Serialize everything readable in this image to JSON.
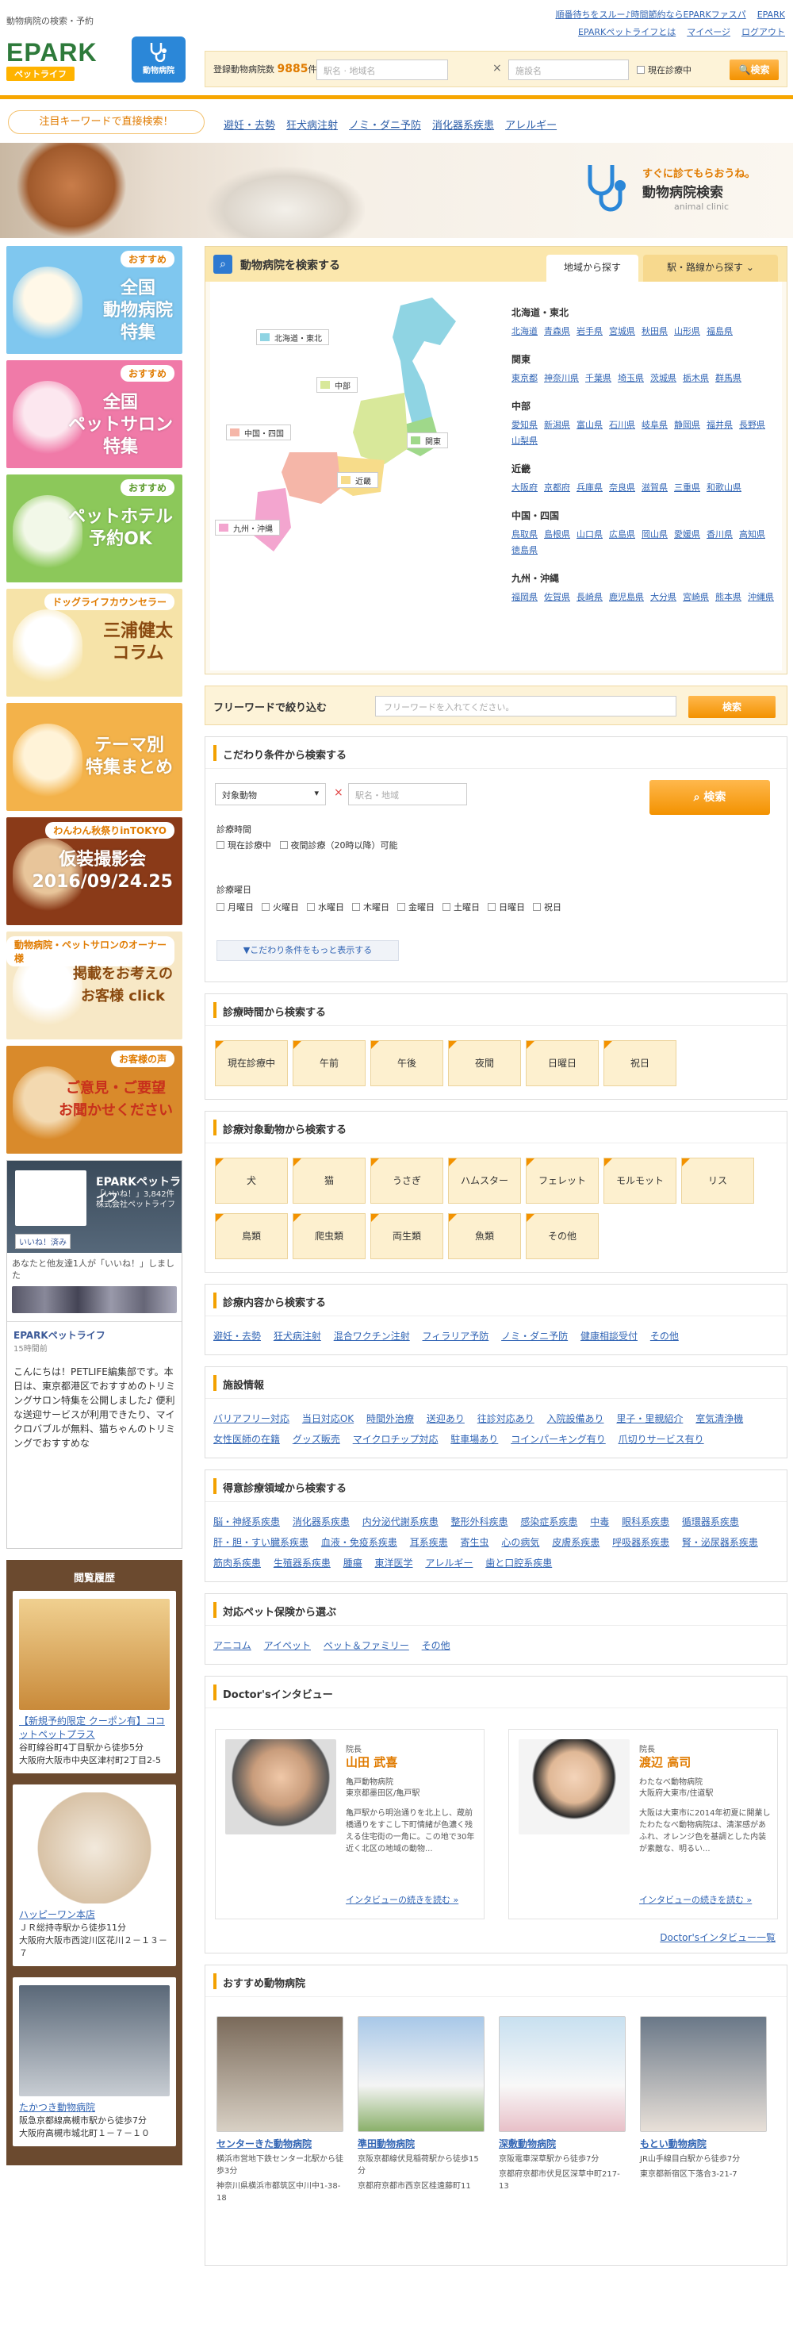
{
  "header": {
    "tagline": "動物病院の検索・予約",
    "logo_text": "EPARK",
    "logo_sub": "ペットライフ",
    "badge_label": "動物病院",
    "top_links": [
      "順番待ちをスルー♪時間節約ならEPARKファスパ",
      "EPARK"
    ],
    "nav_links": [
      "EPARKペットライフとは",
      "マイページ",
      "ログアウト"
    ],
    "registered_label": "登録動物病院数",
    "registered_count": "9885",
    "registered_unit": "件",
    "station_placeholder": "駅名 · 地域名",
    "clinic_placeholder": "施設名",
    "open_now_label": "現在診療中",
    "search_button": "検索"
  },
  "keywords": {
    "label": "注目キーワードで直接検索！",
    "items": [
      "避妊・去勢",
      "狂犬病注射",
      "ノミ・ダニ予防",
      "消化器系疾患",
      "アレルギー"
    ]
  },
  "hero": {
    "line1": "すぐに診てもらおうね。",
    "line2": "動物病院検索",
    "line3": "animal clinic"
  },
  "left_banners": [
    {
      "pill": "おすすめ",
      "title": "全国\n動物病院\n特集",
      "bg": "#7fc7ef"
    },
    {
      "pill": "おすすめ",
      "title": "全国\nペットサロン\n特集",
      "bg": "#f07aa8"
    },
    {
      "pill": "おすすめ",
      "title": "ペットホテル\n予約OK",
      "bg": "#8cc85a"
    },
    {
      "pill": "ドッグライフカウンセラー",
      "title": "三浦健太\nコラム",
      "bg": "#f6e3a8"
    },
    {
      "pill": "",
      "title": "テーマ別\n特集まとめ",
      "bg": "#f3b24a"
    },
    {
      "pill": "わんわん秋祭りinTOKYO",
      "title": "仮装撮影会\n2016/09/24.25",
      "bg": "#8a3a18"
    },
    {
      "pill": "動物病院・ペットサロンのオーナー様",
      "title": "掲載をお考えの\nお客様 click",
      "bg": "#f7e8c6"
    },
    {
      "pill": "お客様の声",
      "title": "ご意見・ご要望\nお聞かせください",
      "bg": "#d98a2b"
    }
  ],
  "facebook": {
    "page_name": "EPARKペットライフ",
    "likes": "「いいね！」3,842件",
    "company": "株式会社ペットライフ",
    "like_button": "いいね！済み",
    "friends_text": "あなたと他友達1人が「いいね！」しました",
    "post_name": "EPARKペットライフ",
    "post_time": "15時間前",
    "post_body": "こんにちは！PETLIFE編集部です。本日は、東京都港区でおすすめのトリミングサロン特集を公開しました♪ 便利な送迎サービスが利用できたり、マイクロバブルが無料、猫ちゃんのトリミングでおすすめな"
  },
  "history": {
    "title": "閲覧履歴",
    "items": [
      {
        "name": "【新規予約限定 クーポン有】ココットペットプラス",
        "access": "谷町線谷町4丁目駅から徒歩5分",
        "address": "大阪府大阪市中央区津村町2丁目2-5"
      },
      {
        "name": "ハッピーワン本店",
        "access": "ＪＲ総持寺駅から徒歩11分",
        "address": "大阪府大阪市西淀川区花川２－１３－７"
      },
      {
        "name": "たかつき動物病院",
        "access": "阪急京都線高槻市駅から徒歩7分",
        "address": "大阪府高槻市城北町１－７－１０"
      }
    ]
  },
  "map_search": {
    "title": "動物病院を検索する",
    "tab_area": "地域から探す",
    "tab_station": "駅・路線から探す",
    "map_tags": [
      "北海道・東北",
      "中部",
      "関東",
      "中国・四国",
      "近畿",
      "九州・沖縄"
    ],
    "regions": [
      {
        "name": "北海道・東北",
        "prefs": [
          "北海道",
          "青森県",
          "岩手県",
          "宮城県",
          "秋田県",
          "山形県",
          "福島県"
        ]
      },
      {
        "name": "関東",
        "prefs": [
          "東京都",
          "神奈川県",
          "千葉県",
          "埼玉県",
          "茨城県",
          "栃木県",
          "群馬県"
        ]
      },
      {
        "name": "中部",
        "prefs": [
          "愛知県",
          "新潟県",
          "富山県",
          "石川県",
          "岐阜県",
          "静岡県",
          "福井県",
          "長野県",
          "山梨県"
        ]
      },
      {
        "name": "近畿",
        "prefs": [
          "大阪府",
          "京都府",
          "兵庫県",
          "奈良県",
          "滋賀県",
          "三重県",
          "和歌山県"
        ]
      },
      {
        "name": "中国・四国",
        "prefs": [
          "鳥取県",
          "島根県",
          "山口県",
          "広島県",
          "岡山県",
          "愛媛県",
          "香川県",
          "高知県",
          "徳島県"
        ]
      },
      {
        "name": "九州・沖縄",
        "prefs": [
          "福岡県",
          "佐賀県",
          "長崎県",
          "鹿児島県",
          "大分県",
          "宮崎県",
          "熊本県",
          "沖縄県"
        ]
      }
    ]
  },
  "free_word": {
    "label": "フリーワードで絞り込む",
    "placeholder": "フリーワードを入れてください。",
    "button": "検索"
  },
  "conditions": {
    "title": "こだわり条件から検索する",
    "select_value": "対象動物",
    "area_placeholder": "駅名・地域",
    "search_button": "検索",
    "time_label": "診療時間",
    "time_opts": [
      "現在診療中",
      "夜間診療（20時以降）可能"
    ],
    "day_label": "診療曜日",
    "days": [
      "月曜日",
      "火曜日",
      "水曜日",
      "木曜日",
      "金曜日",
      "土曜日",
      "日曜日",
      "祝日"
    ],
    "more": "▼こだわり条件をもっと表示する"
  },
  "time_search": {
    "title": "診療時間から検索する",
    "items": [
      "現在診療中",
      "午前",
      "午後",
      "夜間",
      "日曜日",
      "祝日"
    ]
  },
  "animal_search": {
    "title": "診療対象動物から検索する",
    "items": [
      "犬",
      "猫",
      "うさぎ",
      "ハムスター",
      "フェレット",
      "モルモット",
      "リス",
      "鳥類",
      "爬虫類",
      "両生類",
      "魚類",
      "その他"
    ]
  },
  "content_search": {
    "title": "診療内容から検索する",
    "items": [
      "避妊・去勢",
      "狂犬病注射",
      "混合ワクチン注射",
      "フィラリア予防",
      "ノミ・ダニ予防",
      "健康相談受付",
      "その他"
    ]
  },
  "facility": {
    "title": "施設情報",
    "items": [
      "バリアフリー対応",
      "当日対応OK",
      "時間外治療",
      "送迎あり",
      "往診対応あり",
      "入院設備あり",
      "里子・里親紹介",
      "室気清浄機",
      "女性医師の在籍",
      "グッズ販売",
      "マイクロチップ対応",
      "駐車場あり",
      "コインパーキング有り",
      "爪切りサービス有り"
    ]
  },
  "specialty": {
    "title": "得意診療領域から検索する",
    "items": [
      "脳・神経系疾患",
      "消化器系疾患",
      "内分泌代謝系疾患",
      "整形外科疾患",
      "感染症系疾患",
      "中毒",
      "眼科系疾患",
      "循環器系疾患",
      "肝・胆・すい臓系疾患",
      "血液・免疫系疾患",
      "耳系疾患",
      "寄生虫",
      "心の病気",
      "皮膚系疾患",
      "呼吸器系疾患",
      "腎・泌尿器系疾患",
      "筋肉系疾患",
      "生殖器系疾患",
      "腫瘍",
      "東洋医学",
      "アレルギー",
      "歯と口腔系疾患"
    ]
  },
  "insurance": {
    "title": "対応ペット保険から選ぶ",
    "items": [
      "アニコム",
      "アイペット",
      "ペット＆ファミリー",
      "その他"
    ]
  },
  "doctors": {
    "title": "Doctor'sインタビュー",
    "more": "Doctor'sインタビュー一覧",
    "items": [
      {
        "role": "院長",
        "name": "山田 武喜",
        "clinic": "亀戸動物病院",
        "area": "東京都墨田区/亀戸駅",
        "body": "亀戸駅から明治通りを北上し、蔵前橋通りをすこし下町情緒が色濃く残える住宅街の一角に。この地で30年近く北区の地域の動物...",
        "link": "インタビューの続きを読む »"
      },
      {
        "role": "院長",
        "name": "渡辺 高司",
        "clinic": "わたなべ動物病院",
        "area": "大阪府大東市/住道駅",
        "body": "大阪は大東市に2014年初夏に開業したわたなべ動物病院は、清潔感があふれ、オレンジ色を基調とした内装が素敵な、明るい...",
        "link": "インタビューの続きを読む »"
      }
    ]
  },
  "recommend": {
    "title": "おすすめ動物病院",
    "items": [
      {
        "name": "センターきた動物病院",
        "access": "横浜市営地下鉄センター北駅から徒歩3分",
        "address": "神奈川県横浜市都筑区中川中1-38-18"
      },
      {
        "name": "準田動物病院",
        "access": "京阪京都線伏見稲荷駅から徒歩15分",
        "address": "京都府京都市西京区桂遠藤町11"
      },
      {
        "name": "深敷動物病院",
        "access": "京阪電車深草駅から徒歩7分",
        "address": "京都府京都市伏見区深草中町217-13"
      },
      {
        "name": "もとい動物病院",
        "access": "JR山手線目白駅から徒歩7分",
        "address": "東京都新宿区下落合3-21-7"
      }
    ]
  }
}
